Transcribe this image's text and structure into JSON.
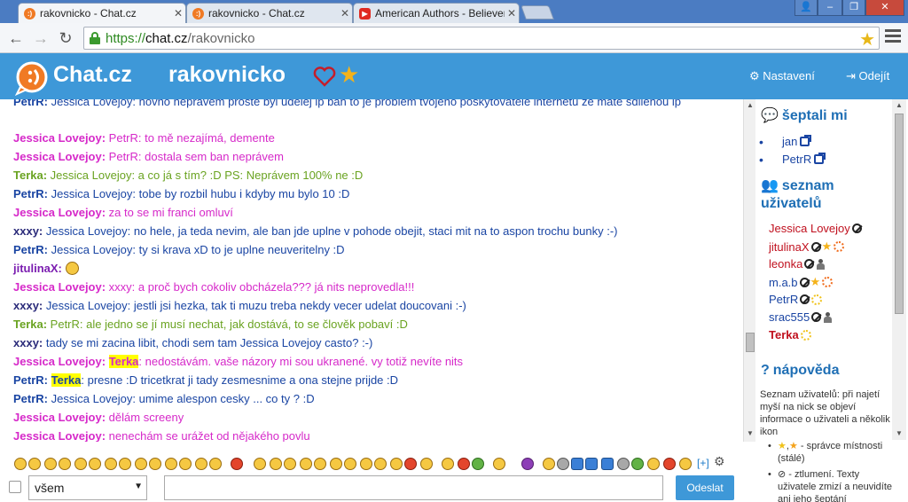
{
  "browser": {
    "tabs": [
      {
        "title": "rakovnicko - Chat.cz",
        "active": true
      },
      {
        "title": "rakovnicko - Chat.cz",
        "active": false
      },
      {
        "title": "American Authors - Believer",
        "active": false
      }
    ],
    "url": {
      "protocol": "https://",
      "domain": "chat.cz",
      "path": "/rakovnicko"
    }
  },
  "header": {
    "logo_text": "Chat.cz",
    "room": "rakovnicko",
    "settings": "Nastavení",
    "logout": "Odejít",
    "brand_color": "#3e98d8"
  },
  "chat": {
    "messages": [
      {
        "nick": "PetrR:",
        "text": " Jessica Lovejoy: novho neprávem proste byl udelej ip ban to je problem tvojeho poskytovatele internetu ze mate sdilenou ip"
      },
      {
        "nick": "Jessica Lovejoy:",
        "text": " PetrR: to mě nezajímá, demente"
      },
      {
        "nick": "Jessica Lovejoy:",
        "text": " PetrR: dostala sem ban neprávem"
      },
      {
        "nick": "Terka:",
        "text": " Jessica Lovejoy: a co já s tím? :D PS: Neprávem 100% ne :D"
      },
      {
        "nick": "PetrR:",
        "text": " Jessica Lovejoy: tobe by rozbil hubu i kdyby mu bylo 10 :D"
      },
      {
        "nick": "Jessica Lovejoy:",
        "text": " za to se mi franci omluví"
      },
      {
        "nick": "xxxy:",
        "text": " Jessica Lovejoy: no hele, ja teda nevim, ale ban jde uplne v pohode obejit, staci mit na to aspon trochu bunky :-)"
      },
      {
        "nick": "PetrR:",
        "text": " Jessica Lovejoy: ty si krava xD to je uplne neuveritelny :D"
      },
      {
        "nick": "jitulinaX:",
        "text": ""
      },
      {
        "nick": "Jessica Lovejoy:",
        "text": " xxxy: a proč bych cokoliv obcházela??? já nits neprovedla!!!"
      },
      {
        "nick": "xxxy:",
        "text": " Jessica Lovejoy: jestli jsi hezka, tak ti muzu treba nekdy vecer udelat doucovani :-)"
      },
      {
        "nick": "Terka:",
        "text": " PetrR: ale jedno se jí musí nechat, jak dostává, to se člověk pobaví :D"
      },
      {
        "nick": "xxxy:",
        "text": " tady se mi zacina libit, chodi sem tam Jessica Lovejoy casto? :-)"
      },
      {
        "nick": "Jessica Lovejoy:",
        "mention": "Terka",
        "text": ": nedostávám. vaše názory mi sou ukranené. vy totiž nevíte nits"
      },
      {
        "nick": "PetrR:",
        "mention": "Terka",
        "text": ": presne :D tricetkrat ji tady zesmesnime a ona stejne prijde :D"
      },
      {
        "nick": "PetrR:",
        "text": " Jessica Lovejoy: umime alespon cesky ... co ty ? :D"
      },
      {
        "nick": "Jessica Lovejoy:",
        "text": " dělám screeny"
      },
      {
        "nick": "Jessica Lovejoy:",
        "text": " nenechám se urážet od nějakého povlu"
      }
    ]
  },
  "sidebar": {
    "whispers_title": "šeptali mi",
    "whispers": [
      "jan",
      "PetrR"
    ],
    "users_title_1": "seznam",
    "users_title_2": "uživatelů",
    "users": [
      {
        "nick": "Jessica Lovejoy",
        "color": "#c0101e"
      },
      {
        "nick": "jitulinaX",
        "color": "#c0101e"
      },
      {
        "nick": "leonka",
        "color": "#c0101e"
      },
      {
        "nick": "m.a.b",
        "color": "#1a45a3"
      },
      {
        "nick": "PetrR",
        "color": "#1a45a3"
      },
      {
        "nick": "srac555",
        "color": "#1a45a3"
      },
      {
        "nick": "Terka",
        "color": "#c0101e"
      }
    ],
    "help_title": "nápověda",
    "help_text": "Seznam uživatelů: při najetí myší na nick se objeví informace o uživateli a několik ikon",
    "help_items": [
      " - správce místnosti (stálé)",
      " - ztlumení. Texty uživatele zmizí a neuvidíte ani jeho šeptání"
    ]
  },
  "composer": {
    "more_smileys": "[+]",
    "target": "všem",
    "send": "Odeslat",
    "message_placeholder": ""
  }
}
